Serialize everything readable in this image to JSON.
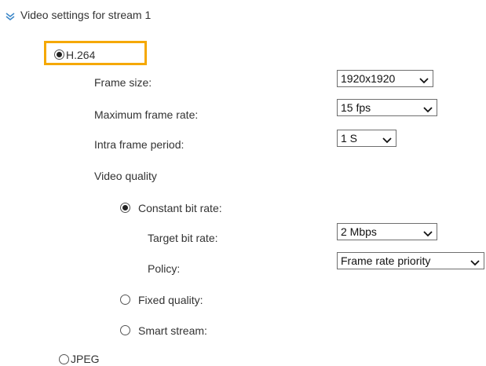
{
  "section": {
    "title": "Video settings for stream 1",
    "icon": "double-chevron-down-icon"
  },
  "codec": {
    "h264_label": "H.264",
    "jpeg_label": "JPEG",
    "selected": "H.264",
    "highlight_color": "#f5a800"
  },
  "fields": {
    "frame_size": {
      "label": "Frame size:",
      "value": "1920x1920"
    },
    "max_frame_rate": {
      "label": "Maximum frame rate:",
      "value": "15 fps"
    },
    "intra_frame_period": {
      "label": "Intra frame period:",
      "value": "1 S"
    }
  },
  "video_quality": {
    "label": "Video quality",
    "constant_bit_rate": {
      "label": "Constant bit rate:",
      "target_bit_rate": {
        "label": "Target bit rate:",
        "value": "2 Mbps"
      },
      "policy": {
        "label": "Policy:",
        "value": "Frame rate priority"
      }
    },
    "fixed_quality": {
      "label": "Fixed quality:"
    },
    "smart_stream": {
      "label": "Smart stream:"
    },
    "selected": "Constant bit rate"
  }
}
